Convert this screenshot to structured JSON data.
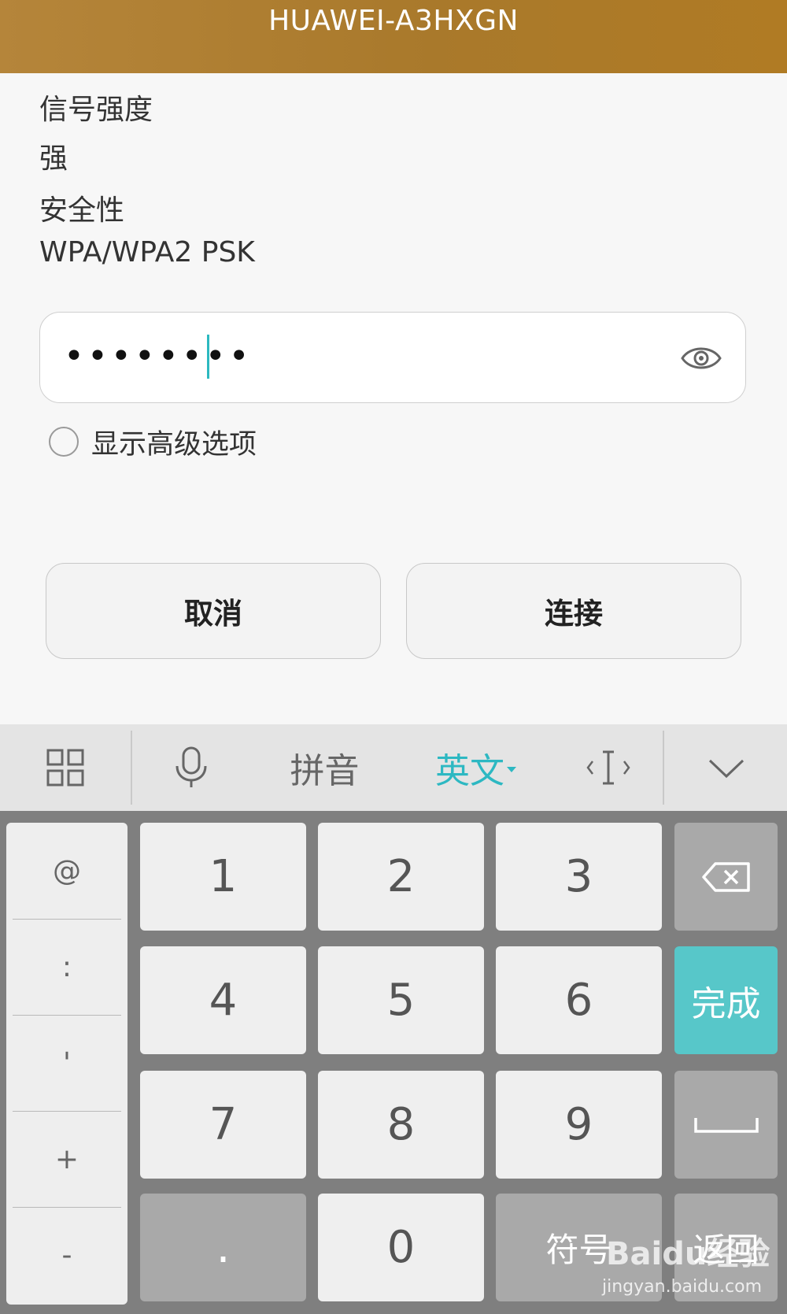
{
  "dialog": {
    "title": "HUAWEI-A3HXGN",
    "signal_label": "信号强度",
    "signal_value": "强",
    "security_label": "安全性",
    "security_value": "WPA/WPA2 PSK",
    "password_masked": "••••••••",
    "show_advanced_label": "显示高级选项",
    "cancel_label": "取消",
    "connect_label": "连接"
  },
  "keyboard": {
    "toolbar": {
      "pinyin_label": "拼音",
      "english_label": "英文",
      "english_active_color": "#2db8c2"
    },
    "side_keys": [
      "@",
      ":",
      "'",
      "+",
      "-"
    ],
    "numbers": [
      "1",
      "2",
      "3",
      "4",
      "5",
      "6",
      "7",
      "8",
      "9"
    ],
    "dot_label": ".",
    "zero_label": "0",
    "symbols_label": "符号",
    "back_label": "返回",
    "done_label": "完成",
    "done_color": "#57c7c9"
  },
  "watermark": {
    "brand": "Baidu经验",
    "url": "jingyan.baidu.com"
  }
}
